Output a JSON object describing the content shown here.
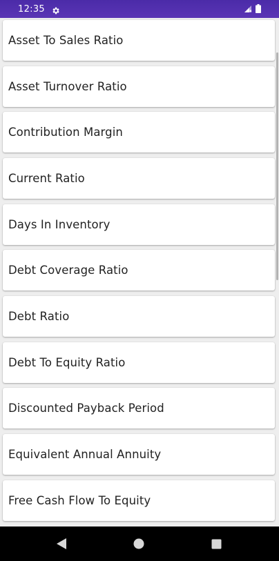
{
  "status_bar": {
    "time": "12:35",
    "settings_icon": "gear-icon",
    "signal_icon": "signal-icon",
    "battery_icon": "battery-icon",
    "background_color": "#5a35b5"
  },
  "list": {
    "items": [
      {
        "label": "Asset To Sales Ratio"
      },
      {
        "label": "Asset Turnover Ratio"
      },
      {
        "label": "Contribution Margin"
      },
      {
        "label": "Current Ratio"
      },
      {
        "label": "Days In Inventory"
      },
      {
        "label": "Debt Coverage Ratio"
      },
      {
        "label": "Debt Ratio"
      },
      {
        "label": "Debt To Equity Ratio"
      },
      {
        "label": "Discounted Payback Period"
      },
      {
        "label": "Equivalent Annual Annuity"
      },
      {
        "label": "Free Cash Flow To Equity"
      }
    ]
  },
  "nav_bar": {
    "back_icon": "back-triangle-icon",
    "home_icon": "home-circle-icon",
    "recents_icon": "recents-square-icon"
  }
}
